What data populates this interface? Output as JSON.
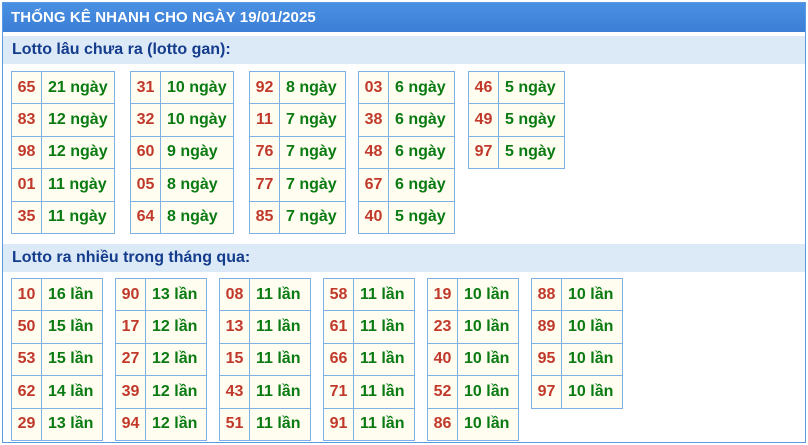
{
  "title": "THỐNG KÊ NHANH CHO NGÀY 19/01/2025",
  "gan": {
    "heading": "Lotto lâu chưa ra (lotto gan):",
    "groups": [
      [
        {
          "num": "65",
          "val": "21 ngày"
        },
        {
          "num": "83",
          "val": "12 ngày"
        },
        {
          "num": "98",
          "val": "12 ngày"
        },
        {
          "num": "01",
          "val": "11 ngày"
        },
        {
          "num": "35",
          "val": "11 ngày"
        }
      ],
      [
        {
          "num": "31",
          "val": "10 ngày"
        },
        {
          "num": "32",
          "val": "10 ngày"
        },
        {
          "num": "60",
          "val": "9 ngày"
        },
        {
          "num": "05",
          "val": "8 ngày"
        },
        {
          "num": "64",
          "val": "8 ngày"
        }
      ],
      [
        {
          "num": "92",
          "val": "8 ngày"
        },
        {
          "num": "11",
          "val": "7 ngày"
        },
        {
          "num": "76",
          "val": "7 ngày"
        },
        {
          "num": "77",
          "val": "7 ngày"
        },
        {
          "num": "85",
          "val": "7 ngày"
        }
      ],
      [
        {
          "num": "03",
          "val": "6 ngày"
        },
        {
          "num": "38",
          "val": "6 ngày"
        },
        {
          "num": "48",
          "val": "6 ngày"
        },
        {
          "num": "67",
          "val": "6 ngày"
        },
        {
          "num": "40",
          "val": "5 ngày"
        }
      ],
      [
        {
          "num": "46",
          "val": "5 ngày"
        },
        {
          "num": "49",
          "val": "5 ngày"
        },
        {
          "num": "97",
          "val": "5 ngày"
        }
      ]
    ]
  },
  "frequent": {
    "heading": "Lotto ra nhiều trong tháng qua:",
    "groups": [
      [
        {
          "num": "10",
          "val": "16 lần"
        },
        {
          "num": "50",
          "val": "15 lần"
        },
        {
          "num": "53",
          "val": "15 lần"
        },
        {
          "num": "62",
          "val": "14 lần"
        },
        {
          "num": "29",
          "val": "13 lần"
        }
      ],
      [
        {
          "num": "90",
          "val": "13 lần"
        },
        {
          "num": "17",
          "val": "12 lần"
        },
        {
          "num": "27",
          "val": "12 lần"
        },
        {
          "num": "39",
          "val": "12 lần"
        },
        {
          "num": "94",
          "val": "12 lần"
        }
      ],
      [
        {
          "num": "08",
          "val": "11 lần"
        },
        {
          "num": "13",
          "val": "11 lần"
        },
        {
          "num": "15",
          "val": "11 lần"
        },
        {
          "num": "43",
          "val": "11 lần"
        },
        {
          "num": "51",
          "val": "11 lần"
        }
      ],
      [
        {
          "num": "58",
          "val": "11 lần"
        },
        {
          "num": "61",
          "val": "11 lần"
        },
        {
          "num": "66",
          "val": "11 lần"
        },
        {
          "num": "71",
          "val": "11 lần"
        },
        {
          "num": "91",
          "val": "11 lần"
        }
      ],
      [
        {
          "num": "19",
          "val": "10 lần"
        },
        {
          "num": "23",
          "val": "10 lần"
        },
        {
          "num": "40",
          "val": "10 lần"
        },
        {
          "num": "52",
          "val": "10 lần"
        },
        {
          "num": "86",
          "val": "10 lần"
        }
      ],
      [
        {
          "num": "88",
          "val": "10 lần"
        },
        {
          "num": "89",
          "val": "10 lần"
        },
        {
          "num": "95",
          "val": "10 lần"
        },
        {
          "num": "97",
          "val": "10 lần"
        }
      ]
    ]
  },
  "colors": {
    "header": "#3b7fd6",
    "section_bg": "#dce9f7",
    "number": "#c0392b",
    "count": "#0a7a12",
    "cell_bg": "#fffdf0"
  }
}
